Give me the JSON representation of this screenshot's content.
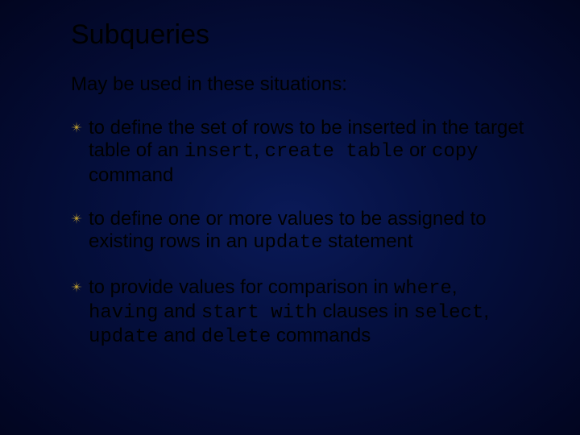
{
  "title": "Subqueries",
  "intro": "May be used in these situations:",
  "bullets": [
    {
      "t0": "to define the set of rows to be inserted in the target table of an ",
      "c0": "insert",
      "t1": ", ",
      "c1": "create table",
      "t2": " or ",
      "c2": "copy",
      "t3": " command"
    },
    {
      "t0": "to define one or more values to be assigned to existing rows in an ",
      "c0": "update",
      "t1": " statement"
    },
    {
      "t0": "to provide values for comparison in ",
      "c0": "where",
      "t1": ", ",
      "c1": "having",
      "t2": " and ",
      "c2": "start with",
      "t3": " clauses in ",
      "c3": "select",
      "t4": ", ",
      "c4": "update",
      "t5": " and ",
      "c5": "delete",
      "t6": " commands"
    }
  ]
}
